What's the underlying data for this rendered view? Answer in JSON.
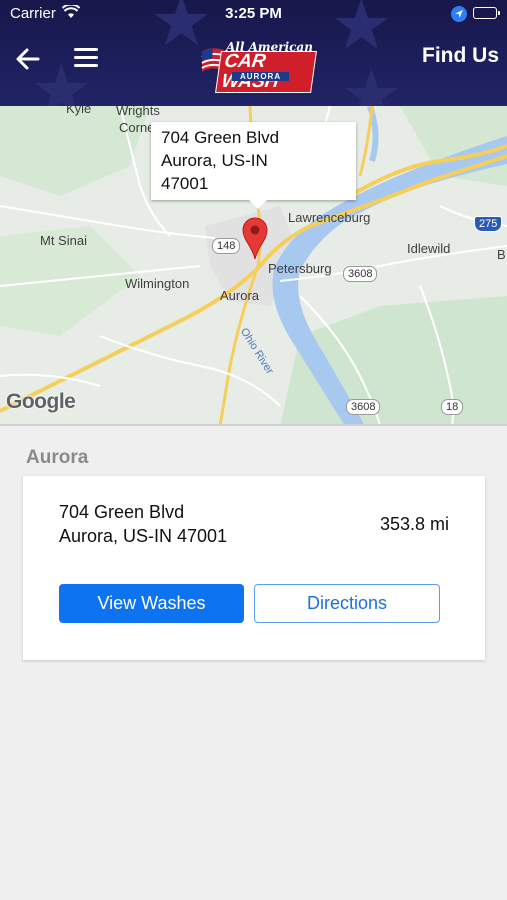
{
  "status_bar": {
    "carrier": "Carrier",
    "time": "3:25 PM"
  },
  "header": {
    "title": "Find Us",
    "logo": {
      "top": "All American",
      "main": "CAR WASH",
      "sub": "AURORA"
    }
  },
  "map": {
    "callout": {
      "line1": "704 Green Blvd",
      "line2": "Aurora, US-IN",
      "line3": "47001"
    },
    "labels": {
      "kyle": "Kyle",
      "wrights": "Wrights",
      "corner": "Corne",
      "lawrenceburg": "Lawrenceburg",
      "mt_sinai": "Mt Sinai",
      "idlewild": "Idlewild",
      "b": "B",
      "petersburg": "Petersburg",
      "wilmington": "Wilmington",
      "aurora": "Aurora",
      "ohio_river": "Ohio River"
    },
    "shields": {
      "r148": "148",
      "r3608a": "3608",
      "r3608b": "3608",
      "r18": "18",
      "i275": "275"
    },
    "attribution": "Google"
  },
  "location": {
    "section_title": "Aurora",
    "address_line1": "704 Green Blvd",
    "address_line2": "Aurora, US-IN  47001",
    "distance": "353.8 mi",
    "view_washes_label": "View Washes",
    "directions_label": "Directions"
  },
  "colors": {
    "header_bg": "#1d1f5c",
    "primary": "#0d73f0",
    "outline": "#5b9bf0",
    "river": "#a7c9f0"
  }
}
